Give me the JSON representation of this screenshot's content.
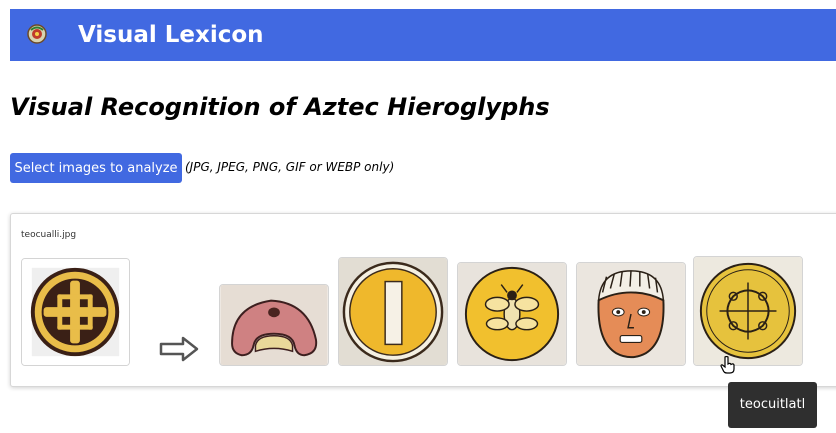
{
  "app": {
    "title": "Visual Lexicon",
    "logo_icon": "glyph-logo-icon"
  },
  "page": {
    "heading": "Visual Recognition of Aztec Hieroglyphs"
  },
  "upload": {
    "button_label": "Select images to analyze",
    "hint": "(JPG, JPEG, PNG, GIF or WEBP only)"
  },
  "result": {
    "file_name": "teocualli.jpg",
    "query_image": "gold-cross-disk-glyph",
    "arrow_icon": "right-arrow-icon",
    "matches": [
      {
        "glyph": "red-glyph"
      },
      {
        "glyph": "gold-disk-with-bar-glyph"
      },
      {
        "glyph": "gold-disk-with-insect-glyph"
      },
      {
        "glyph": "face-glyph"
      },
      {
        "glyph": "gold-disk-with-quatrefoil-glyph"
      }
    ],
    "tooltip": "teocuitlatl"
  },
  "colors": {
    "accent": "#4169e1",
    "gold": "#e8b83a",
    "tooltip_bg": "#2f2f2f"
  }
}
